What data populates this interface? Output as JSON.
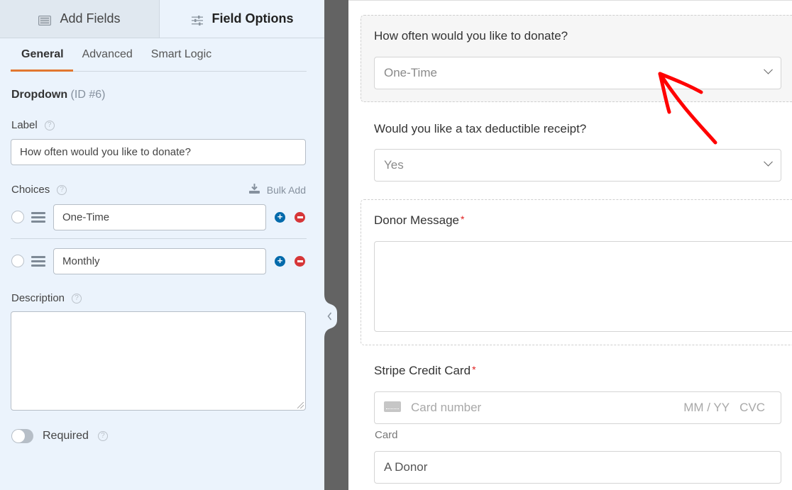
{
  "left_panel": {
    "tabs": [
      {
        "label": "Add Fields",
        "icon": "list-icon",
        "active": false
      },
      {
        "label": "Field Options",
        "icon": "sliders-icon",
        "active": true
      }
    ],
    "sub_tabs": [
      {
        "label": "General",
        "active": true
      },
      {
        "label": "Advanced",
        "active": false
      },
      {
        "label": "Smart Logic",
        "active": false
      }
    ],
    "field_type": "Dropdown",
    "field_id": "(ID #6)",
    "label_caption": "Label",
    "label_value": "How often would you like to donate?",
    "choices_caption": "Choices",
    "bulk_add_label": "Bulk Add",
    "choices": [
      {
        "value": "One-Time"
      },
      {
        "value": "Monthly"
      }
    ],
    "description_caption": "Description",
    "description_value": "",
    "required_label": "Required",
    "required_on": false,
    "help_glyph": "?"
  },
  "preview": {
    "fields": [
      {
        "label": "How often would you like to donate?",
        "type": "dropdown",
        "value": "One-Time",
        "selected": true
      },
      {
        "label": "Would you like a tax deductible receipt?",
        "type": "dropdown",
        "value": "Yes"
      },
      {
        "label": "Donor Message",
        "type": "textarea",
        "required": true,
        "value": ""
      },
      {
        "label": "Stripe Credit Card",
        "type": "stripe",
        "required": true,
        "card_placeholder": "Card number",
        "expiry_placeholder": "MM / YY",
        "cvc_placeholder": "CVC",
        "sublabel": "Card",
        "name_value": "A Donor"
      }
    ],
    "required_mark": "*"
  },
  "colors": {
    "accent_orange": "#e27730",
    "panel_bg": "#ebf3fc",
    "add_blue": "#036aab",
    "remove_red": "#d63638",
    "annotation_red": "#ff0000"
  }
}
